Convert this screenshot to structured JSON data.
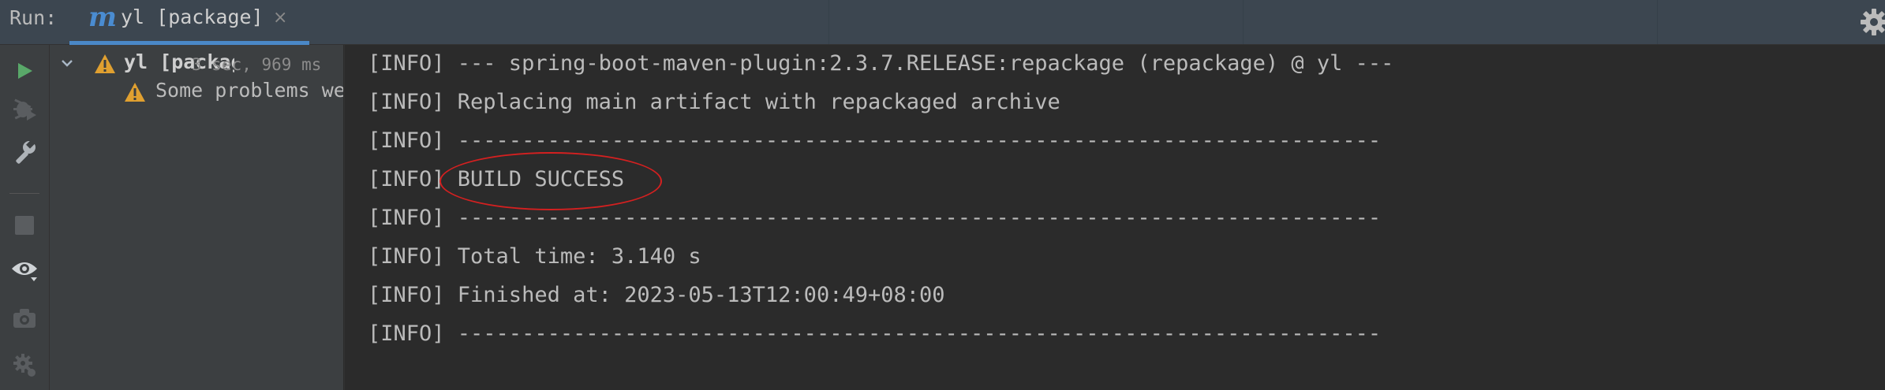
{
  "topbar": {
    "run_label": "Run:",
    "tab": {
      "icon": "maven-icon",
      "title": "yl [package]",
      "close_glyph": "×"
    }
  },
  "toolbar": {
    "icons": [
      "rerun-icon",
      "debug-rerun-icon",
      "wrench-icon",
      "stop-icon",
      "eye-icon",
      "camera-icon",
      "settings-gear-icon"
    ]
  },
  "tree": {
    "root": {
      "name": "yl [package]",
      "elapsed": "3 sec, 969 ms",
      "status": "warning"
    },
    "child": {
      "label": "Some problems were encountered while building the effective model",
      "status": "warning"
    }
  },
  "console": {
    "lines": [
      "[INFO] --- spring-boot-maven-plugin:2.3.7.RELEASE:repackage (repackage) @ yl ---",
      "[INFO] Replacing main artifact with repackaged archive",
      "[INFO] ------------------------------------------------------------------------",
      "[INFO] BUILD SUCCESS",
      "[INFO] ------------------------------------------------------------------------",
      "[INFO] Total time: 3.140 s",
      "[INFO] Finished at: 2023-05-13T12:00:49+08:00",
      "[INFO] ------------------------------------------------------------------------"
    ],
    "highlight_color": "#d42020"
  },
  "colors": {
    "accent_blue": "#4a88c7",
    "run_green": "#59a869",
    "warning_yellow": "#e0a030"
  }
}
